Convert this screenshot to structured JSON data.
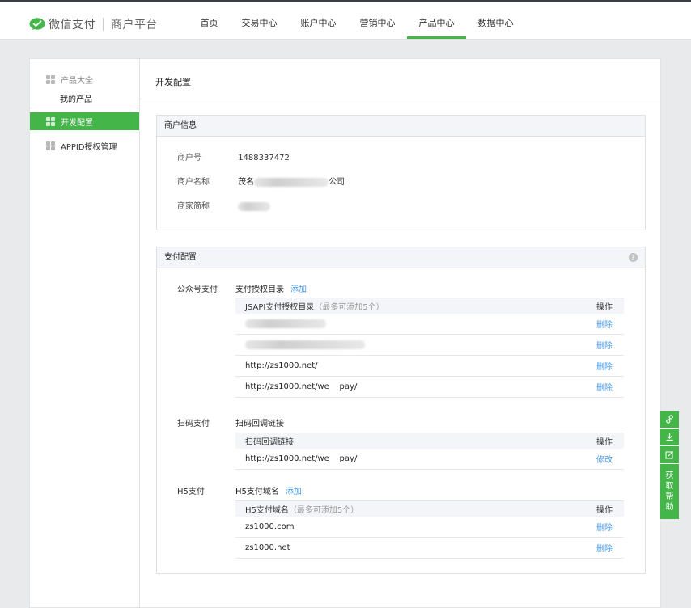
{
  "header": {
    "brand": "微信支付",
    "platform": "商户平台",
    "nav": [
      {
        "label": "首页",
        "active": false
      },
      {
        "label": "交易中心",
        "active": false
      },
      {
        "label": "账户中心",
        "active": false
      },
      {
        "label": "营销中心",
        "active": false
      },
      {
        "label": "产品中心",
        "active": true
      },
      {
        "label": "数据中心",
        "active": false
      }
    ]
  },
  "sidebar": {
    "group": "产品大全",
    "sub": "我的产品",
    "items": [
      {
        "label": "开发配置",
        "active": true
      },
      {
        "label": "APPID授权管理",
        "active": false
      }
    ]
  },
  "page": {
    "title": "开发配置"
  },
  "merchant": {
    "title": "商户信息",
    "rows": [
      {
        "label": "商户号",
        "value": "1488337472"
      },
      {
        "label": "商户名称",
        "prefix": "茂名",
        "suffix": "公司"
      },
      {
        "label": "商家简称",
        "prefix": "",
        "suffix": ""
      }
    ]
  },
  "pay": {
    "title": "支付配置",
    "help": "?",
    "jsapi": {
      "label": "公众号支付",
      "title": "支付授权目录",
      "add": "添加",
      "header": "JSAPI支付授权目录",
      "hint": "（最多可添加5个）",
      "op": "操作",
      "rows": [
        {
          "value": "",
          "action": "删除"
        },
        {
          "value": "",
          "action": "删除"
        },
        {
          "value": "http://zs1000.net/",
          "action": "删除"
        },
        {
          "value": "http://zs1000.net/we    pay/",
          "action": "删除"
        }
      ]
    },
    "native": {
      "label": "扫码支付",
      "title": "扫码回调链接",
      "header": "扫码回调链接",
      "op": "操作",
      "rows": [
        {
          "value": "http://zs1000.net/we    pay/",
          "action": "修改"
        }
      ]
    },
    "h5": {
      "label": "H5支付",
      "title": "H5支付域名",
      "add": "添加",
      "header": "H5支付域名",
      "hint": "（最多可添加5个）",
      "op": "操作",
      "rows": [
        {
          "value": "zs1000.com",
          "action": "删除"
        },
        {
          "value": "zs1000.net",
          "action": "删除"
        }
      ]
    }
  },
  "float": {
    "help": "获取帮助"
  },
  "colors": {
    "accent": "#44b549",
    "link": "#459ae9",
    "topbar": "#3b3f45"
  }
}
